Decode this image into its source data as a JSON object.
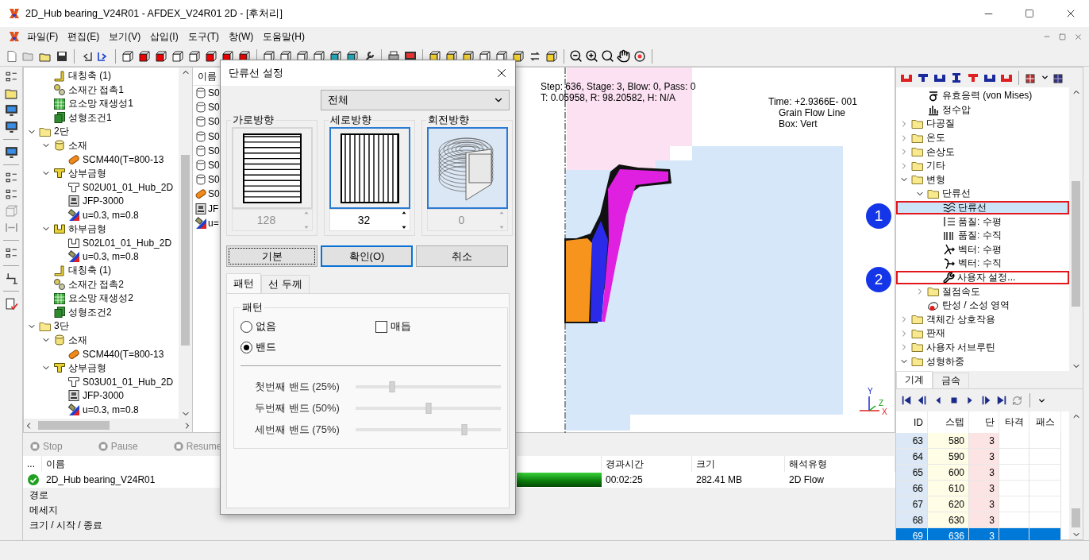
{
  "window": {
    "title": "2D_Hub bearing_V24R01 - AFDEX_V24R01 2D - [후처리]"
  },
  "menu": [
    "파일(F)",
    "편집(E)",
    "보기(V)",
    "삽입(I)",
    "도구(T)",
    "창(W)",
    "도움말(H)"
  ],
  "model_tree": [
    {
      "kind": "group",
      "children": [
        {
          "label": "대칭축 (1)",
          "kind": "axis"
        },
        {
          "label": "소재간 접촉1",
          "kind": "contact"
        },
        {
          "label": "요소망 재생성1",
          "kind": "remesh"
        },
        {
          "label": "성형조건1",
          "kind": "condition"
        }
      ]
    },
    {
      "label": "2단",
      "kind": "folder",
      "expanded": true,
      "children": [
        {
          "label": "소재",
          "kind": "material",
          "expanded": true,
          "children": [
            {
              "label": "SCM440(T=800-13",
              "kind": "alloy"
            }
          ]
        },
        {
          "label": "상부금형",
          "kind": "upper-die",
          "expanded": true,
          "children": [
            {
              "label": "S02U01_01_Hub_2D",
              "kind": "die-file"
            },
            {
              "label": "JFP-3000",
              "kind": "press"
            },
            {
              "label": "u=0.3, m=0.8",
              "kind": "friction"
            }
          ]
        },
        {
          "label": "하부금형",
          "kind": "lower-die",
          "expanded": true,
          "children": [
            {
              "label": "S02L01_01_Hub_2D",
              "kind": "lower-die-file"
            },
            {
              "label": "u=0.3, m=0.8",
              "kind": "friction"
            }
          ]
        },
        {
          "label": "대칭축 (1)",
          "kind": "axis"
        },
        {
          "label": "소재간 접촉2",
          "kind": "contact"
        },
        {
          "label": "요소망 재생성2",
          "kind": "remesh"
        },
        {
          "label": "성형조건2",
          "kind": "condition"
        }
      ]
    },
    {
      "label": "3단",
      "kind": "folder",
      "expanded": true,
      "children": [
        {
          "label": "소재",
          "kind": "material",
          "expanded": true,
          "children": [
            {
              "label": "SCM440(T=800-13",
              "kind": "alloy"
            }
          ]
        },
        {
          "label": "상부금형",
          "kind": "upper-die",
          "expanded": true,
          "children": [
            {
              "label": "S03U01_01_Hub_2D",
              "kind": "die-file"
            },
            {
              "label": "JFP-3000",
              "kind": "press"
            },
            {
              "label": "u=0.3, m=0.8",
              "kind": "friction"
            }
          ]
        }
      ]
    }
  ],
  "object_list": {
    "header": "이름",
    "items": [
      {
        "label": "S0",
        "kind": "cylinder"
      },
      {
        "label": "S0",
        "kind": "cylinder"
      },
      {
        "label": "S0",
        "kind": "cylinder"
      },
      {
        "label": "S0",
        "kind": "cylinder"
      },
      {
        "label": "S0",
        "kind": "cylinder"
      },
      {
        "label": "S0",
        "kind": "cylinder"
      },
      {
        "label": "S0",
        "kind": "cylinder"
      },
      {
        "label": "S0",
        "kind": "alloy"
      },
      {
        "label": "JF",
        "kind": "press"
      },
      {
        "label": "u=",
        "kind": "friction"
      }
    ]
  },
  "job_controls": [
    {
      "label": "Stop",
      "disabled": true
    },
    {
      "label": "Pause",
      "disabled": true
    },
    {
      "label": "Resume",
      "disabled": true
    }
  ],
  "jobs": {
    "columns": [
      "...",
      "이름",
      "경과시간",
      "크기",
      "해석유형"
    ],
    "rows": [
      {
        "kind": "done",
        "name": "2D_Hub bearing_V24R01",
        "level": 1,
        "elapsed": "00:02:25",
        "size": "282.41 MB",
        "type": "2D Flow"
      }
    ],
    "details": [
      "경로",
      "메세지",
      "크기 / 시작 / 종료"
    ]
  },
  "viewport": {
    "info_lines": [
      "Step: 636, Stage: 3, Blow: 0, Pass: 0",
      "T: 0.05958, R: 98.20582, H: N/A"
    ],
    "legend_lines": [
      "Time: +2.9366E- 001",
      "Grain Flow Line",
      "Box: Vert"
    ],
    "axis_labels": [
      "Y",
      "Z",
      "X"
    ]
  },
  "dialog": {
    "title": "단류선 설정",
    "filter": "전체",
    "directions": [
      {
        "label": "가로방향",
        "kind": "horizontal",
        "value": "128",
        "highlighted": false,
        "hovered": false,
        "disabled": true
      },
      {
        "label": "세로방향",
        "kind": "vertical",
        "value": "32",
        "highlighted": true,
        "hovered": false,
        "disabled": false
      },
      {
        "label": "회전방향",
        "kind": "rotational",
        "value": "0",
        "highlighted": true,
        "hovered": true,
        "disabled": true
      }
    ],
    "buttons": [
      {
        "label": "기본",
        "focused": true,
        "default": false
      },
      {
        "label": "확인(O)",
        "focused": false,
        "default": true
      },
      {
        "label": "취소",
        "focused": false,
        "default": false
      }
    ],
    "tabs": [
      {
        "label": "패턴",
        "selected": true
      },
      {
        "label": "선 두께",
        "selected": false
      }
    ],
    "group_title": "패턴",
    "radios": [
      {
        "label": "없음",
        "selected": false
      },
      {
        "label": "밴드",
        "selected": true
      }
    ],
    "checkbox": {
      "label": "매듭",
      "checked": false
    },
    "sliders": [
      {
        "label": "첫번째 밴드 (25%)",
        "level": 0.25
      },
      {
        "label": "두번째 밴드 (50%)",
        "level": 0.5
      },
      {
        "label": "세번째 밴드 (75%)",
        "level": 0.75
      }
    ]
  },
  "result_tree": [
    {
      "kind": "group",
      "children": [
        {
          "label": "유효응력 (von Mises)",
          "kind": "sigma",
          "selected": false,
          "highlighted": false
        },
        {
          "label": "정수압",
          "kind": "pressure",
          "selected": false,
          "highlighted": false
        }
      ]
    },
    {
      "label": "다공질",
      "kind": "folder",
      "expanded": false,
      "selected": false,
      "highlighted": false
    },
    {
      "label": "온도",
      "kind": "folder",
      "expanded": false,
      "selected": false,
      "highlighted": false
    },
    {
      "label": "손상도",
      "kind": "folder",
      "expanded": false,
      "selected": false,
      "highlighted": false
    },
    {
      "label": "기타",
      "kind": "folder",
      "expanded": false,
      "selected": false,
      "highlighted": false
    },
    {
      "label": "변형",
      "kind": "folder",
      "expanded": true,
      "selected": false,
      "highlighted": false,
      "children": [
        {
          "label": "단류선",
          "kind": "folder",
          "expanded": true,
          "selected": false,
          "highlighted": false,
          "children": [
            {
              "label": "단류선",
              "kind": "flowline",
              "selected": true,
              "highlighted": true
            },
            {
              "label": "품질: 수평",
              "kind": "quality-h",
              "selected": false,
              "highlighted": false
            },
            {
              "label": "품질: 수직",
              "kind": "quality-v",
              "selected": false,
              "highlighted": false
            },
            {
              "label": "벡터: 수평",
              "kind": "vector-h",
              "selected": false,
              "highlighted": false
            },
            {
              "label": "벡터: 수직",
              "kind": "vector-v",
              "selected": false,
              "highlighted": false
            },
            {
              "label": "사용자 설정...",
              "kind": "wrench",
              "selected": false,
              "highlighted": true
            }
          ]
        },
        {
          "label": "절점속도",
          "kind": "folder",
          "expanded": false,
          "selected": false,
          "highlighted": false
        },
        {
          "label": "탄성 / 소성 영역",
          "kind": "elastic",
          "selected": false,
          "highlighted": false
        }
      ]
    },
    {
      "label": "객체간 상호작용",
      "kind": "folder",
      "expanded": false,
      "selected": false,
      "highlighted": false
    },
    {
      "label": "판재",
      "kind": "folder",
      "expanded": false,
      "selected": false,
      "highlighted": false
    },
    {
      "label": "사용자 서브루틴",
      "kind": "folder",
      "expanded": false,
      "selected": false,
      "highlighted": false
    },
    {
      "label": "성형하중",
      "kind": "folder",
      "expanded": true,
      "selected": false,
      "highlighted": false
    }
  ],
  "callouts": [
    "1",
    "2"
  ],
  "panel_tabs": [
    {
      "label": "기계",
      "selected": true
    },
    {
      "label": "금속",
      "selected": false
    }
  ],
  "steps_table": {
    "columns": [
      "ID",
      "스텝",
      "단",
      "타격",
      "패스"
    ],
    "rows": [
      {
        "id": "63",
        "step": "580",
        "stage": "3",
        "selected": false
      },
      {
        "id": "64",
        "step": "590",
        "stage": "3",
        "selected": false
      },
      {
        "id": "65",
        "step": "600",
        "stage": "3",
        "selected": false
      },
      {
        "id": "66",
        "step": "610",
        "stage": "3",
        "selected": false
      },
      {
        "id": "67",
        "step": "620",
        "stage": "3",
        "selected": false
      },
      {
        "id": "68",
        "step": "630",
        "stage": "3",
        "selected": false
      },
      {
        "id": "69",
        "step": "636",
        "stage": "3",
        "selected": true
      }
    ]
  }
}
